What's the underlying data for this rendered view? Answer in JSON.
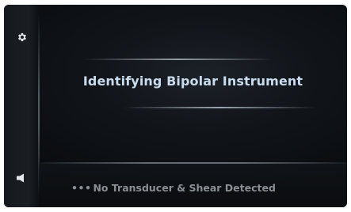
{
  "sidebar": {
    "top_icon": "gear-icon",
    "bottom_icon": "speaker-icon"
  },
  "main": {
    "title": "Identifying Bipolar Instrument"
  },
  "status_bar": {
    "indicator": "•••",
    "message": "No Transducer & Shear Detected"
  },
  "colors": {
    "title_text": "#c9dced",
    "status_text": "#8b8f93",
    "background": "#0d1014"
  }
}
